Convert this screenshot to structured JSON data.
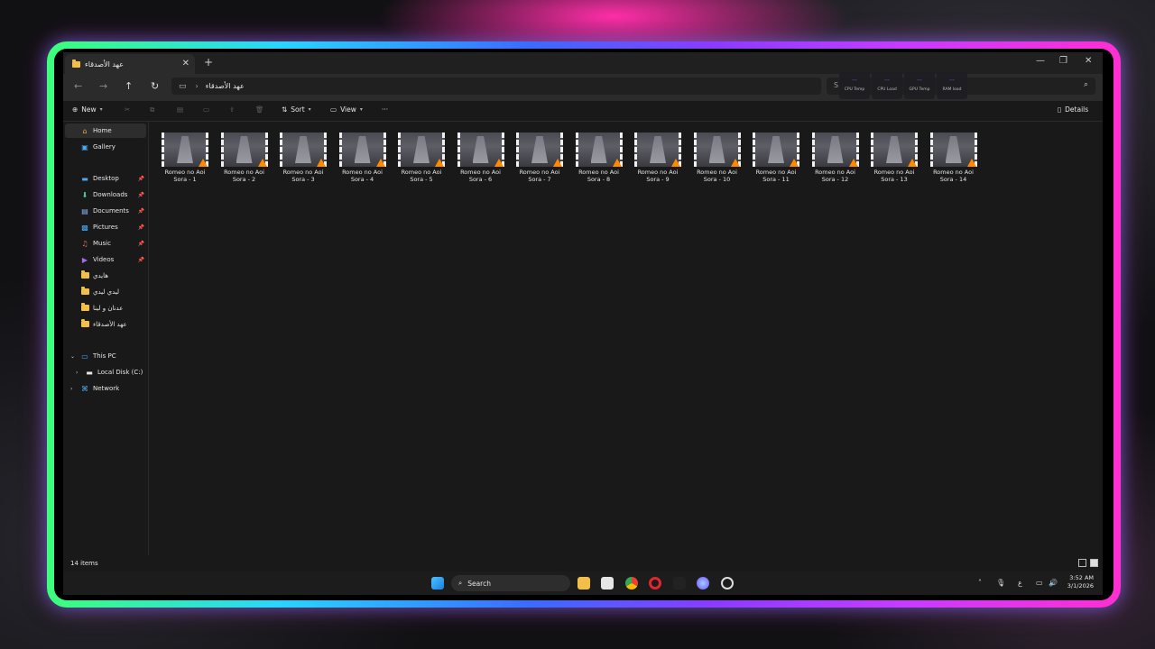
{
  "window": {
    "tab_title": "عهد الأصدقاء",
    "new_tab": "+",
    "close_tab": "✕",
    "minimize": "—",
    "maximize": "❐",
    "close": "✕"
  },
  "address": {
    "path": "عهد الأصدقاء",
    "search_placeholder": "S"
  },
  "overlay_widgets": [
    {
      "value": "--",
      "label": "CPU Temp"
    },
    {
      "value": "--",
      "label": "CPU Load"
    },
    {
      "value": "--",
      "label": "GPU Temp"
    },
    {
      "value": "--",
      "label": "RAM load"
    }
  ],
  "toolbar": {
    "new_label": "New",
    "sort_label": "Sort",
    "view_label": "View",
    "more_label": "···",
    "details_label": "Details"
  },
  "nav": {
    "home": "Home",
    "gallery": "Gallery",
    "desktop": "Desktop",
    "downloads": "Downloads",
    "documents": "Documents",
    "pictures": "Pictures",
    "music": "Music",
    "videos": "Videos",
    "folders": [
      "هايدي",
      "ليدي ليدي",
      "عدنان و لينا",
      "عهد الأصدقاء"
    ],
    "this_pc": "This PC",
    "local_disk": "Local Disk (C:)",
    "network": "Network"
  },
  "files": [
    {
      "line1": "Romeo no Aoi",
      "line2": "Sora - 1"
    },
    {
      "line1": "Romeo no Aoi",
      "line2": "Sora - 2"
    },
    {
      "line1": "Romeo no Aoi",
      "line2": "Sora - 3"
    },
    {
      "line1": "Romeo no Aoi",
      "line2": "Sora - 4"
    },
    {
      "line1": "Romeo no Aoi",
      "line2": "Sora - 5"
    },
    {
      "line1": "Romeo no Aoi",
      "line2": "Sora - 6"
    },
    {
      "line1": "Romeo no Aoi",
      "line2": "Sora - 7"
    },
    {
      "line1": "Romeo no Aoi",
      "line2": "Sora - 8"
    },
    {
      "line1": "Romeo no Aoi",
      "line2": "Sora - 9"
    },
    {
      "line1": "Romeo no Aoi",
      "line2": "Sora - 10"
    },
    {
      "line1": "Romeo no Aoi",
      "line2": "Sora - 11"
    },
    {
      "line1": "Romeo no Aoi",
      "line2": "Sora - 12"
    },
    {
      "line1": "Romeo no Aoi",
      "line2": "Sora - 13"
    },
    {
      "line1": "Romeo no Aoi",
      "line2": "Sora - 14"
    }
  ],
  "status": {
    "item_count": "14 items"
  },
  "taskbar": {
    "search_label": "Search",
    "lang": "ع",
    "time": "3:52 AM",
    "date": "3/1/2026"
  },
  "colors": {
    "frame_gradient": [
      "#3dff7a",
      "#2ad4ff",
      "#3b6bff",
      "#8a3cff",
      "#c63cff",
      "#ff2fd0"
    ],
    "folder": "#f2c04a",
    "window_bg": "#191919"
  }
}
